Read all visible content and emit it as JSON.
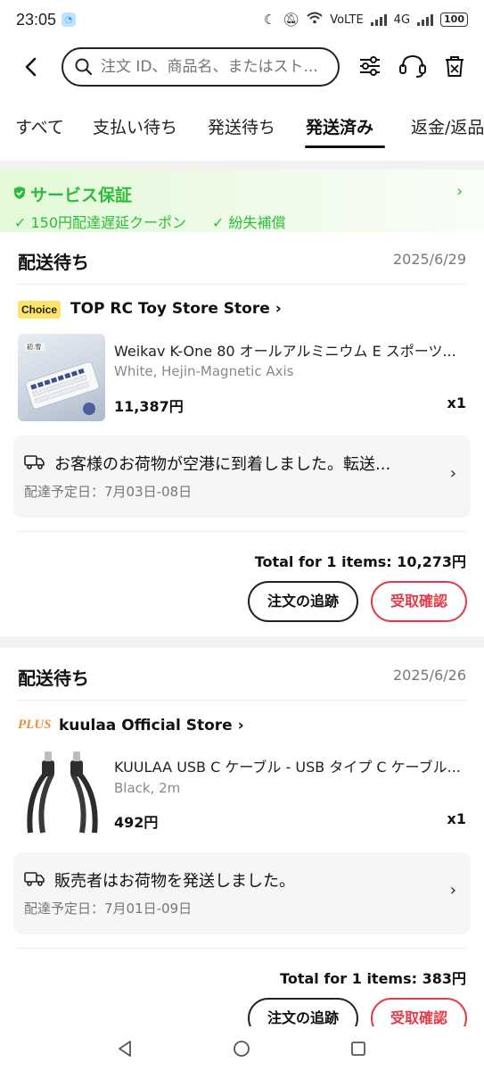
{
  "status_bar": {
    "time": "23:05",
    "network_label": "VoLTE",
    "network_gen": "4G",
    "battery": "100"
  },
  "header": {
    "search_placeholder": "注文 ID、商品名、またはスト..."
  },
  "tabs": [
    {
      "label": "すべて",
      "active": false
    },
    {
      "label": "支払い待ち",
      "active": false
    },
    {
      "label": "発送待ち",
      "active": false
    },
    {
      "label": "発送済み",
      "active": true
    },
    {
      "label": "返金/返品",
      "active": false
    }
  ],
  "guarantee": {
    "title": "サービス保証",
    "items": [
      "150円配達遅延クーポン",
      "紛失補償"
    ],
    "color": "#2ebd3b"
  },
  "orders": [
    {
      "status": "配送待ち",
      "date": "2025/6/29",
      "badge": "Choice",
      "store": "TOP RC Toy Store Store",
      "product_title": "Weikav K-One 80 オールアルミニウム E スポーツ...",
      "variant": "White, Hejin-Magnetic Axis",
      "thumb_caption": "初.雪",
      "price": "11,387円",
      "qty": "x1",
      "shipping_message": "お客様のお荷物が空港に到着しました。転送...",
      "eta": "配達予定日：7月03日-08日",
      "total": "Total for 1 items: 10,273円",
      "track_label": "注文の追跡",
      "confirm_label": "受取確認"
    },
    {
      "status": "配送待ち",
      "date": "2025/6/26",
      "badge": "PLUS",
      "store": "kuulaa Official Store",
      "product_title": "KUULAA USB C ケーブル - USB タイプ C ケーブル...",
      "variant": "Black, 2m",
      "price": "492円",
      "qty": "x1",
      "shipping_message": "販売者はお荷物を発送しました。",
      "eta": "配達予定日：7月01日-09日",
      "total": "Total for 1 items: 383円",
      "track_label": "注文の追跡",
      "confirm_label": "受取確認"
    }
  ],
  "colors": {
    "accent_red": "#e23a47",
    "choice_yellow": "#fde36a",
    "plus_orange": "#e6903c"
  }
}
